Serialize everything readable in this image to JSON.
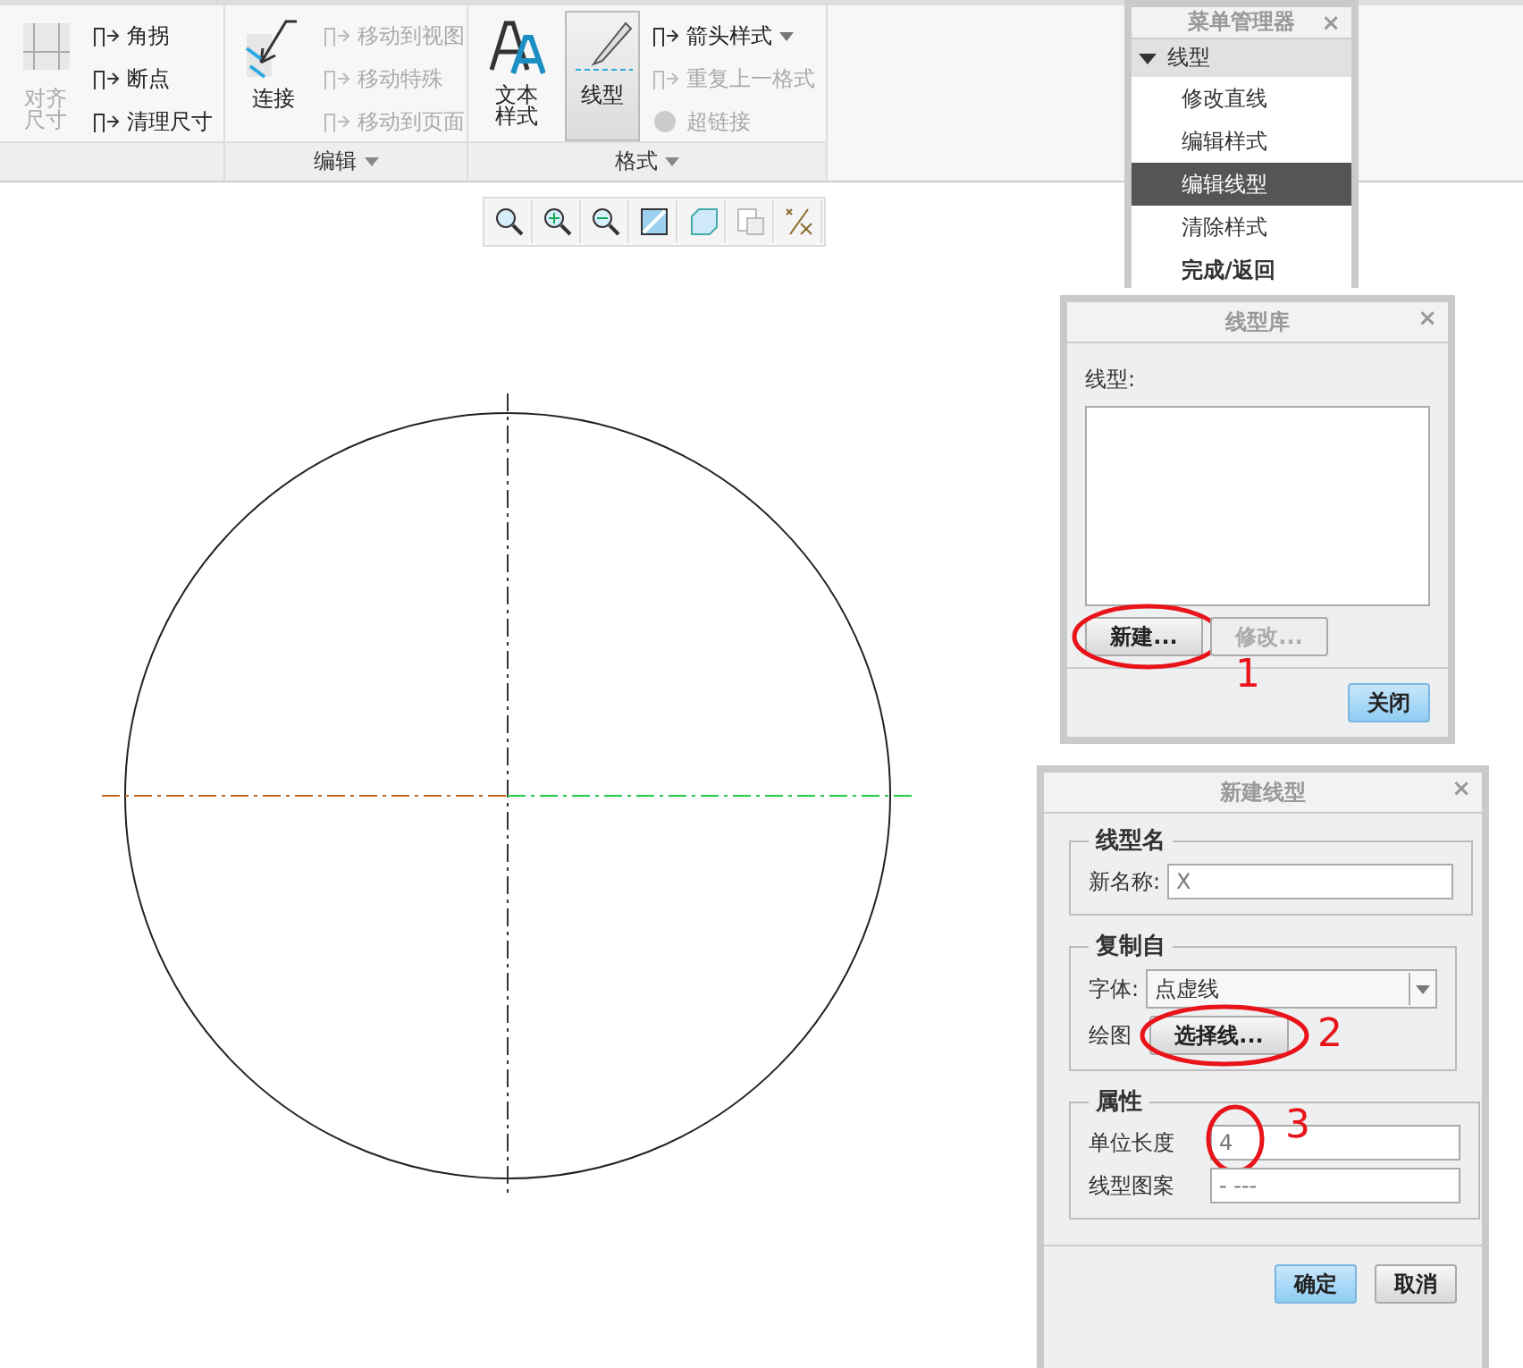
{
  "ribbon": {
    "groups": [
      {
        "items": [
          {
            "kind": "large",
            "label": "对齐尺寸",
            "disabled": true,
            "selected": false
          },
          {
            "kind": "small",
            "label": "角拐",
            "disabled": false
          },
          {
            "kind": "small",
            "label": "断点",
            "disabled": false
          },
          {
            "kind": "small",
            "label": "清理尺寸",
            "disabled": false
          }
        ]
      },
      {
        "label": "编辑",
        "items": [
          {
            "kind": "large",
            "label": "连接",
            "disabled": false,
            "selected": false
          },
          {
            "kind": "small",
            "label": "移动到视图",
            "disabled": true
          },
          {
            "kind": "small",
            "label": "移动特殊",
            "disabled": true
          },
          {
            "kind": "small",
            "label": "移动到页面",
            "disabled": true
          }
        ]
      },
      {
        "label": "格式",
        "items": [
          {
            "kind": "large",
            "label": "文本样式",
            "disabled": false,
            "selected": false
          },
          {
            "kind": "large",
            "label": "线型",
            "disabled": false,
            "selected": true
          },
          {
            "kind": "small",
            "label": "箭头样式",
            "disabled": false,
            "dropdown": true
          },
          {
            "kind": "small",
            "label": "重复上一格式",
            "disabled": true
          },
          {
            "kind": "small",
            "label": "超链接",
            "disabled": true
          }
        ]
      }
    ]
  },
  "menu_manager": {
    "title": "菜单管理器",
    "close": "×",
    "section": "线型",
    "items": [
      {
        "label": "修改直线",
        "kind": "option",
        "selected": false
      },
      {
        "label": "编辑样式",
        "kind": "option",
        "selected": false
      },
      {
        "label": "编辑线型",
        "kind": "option",
        "selected": true
      },
      {
        "label": "清除样式",
        "kind": "option",
        "selected": false
      },
      {
        "label": "完成/返回",
        "kind": "action",
        "selected": false
      }
    ]
  },
  "linetype_library": {
    "title": "线型库",
    "close": "×",
    "list_label": "线型:",
    "buttons": [
      {
        "label": "新建...",
        "disabled": false,
        "circled": true,
        "note": "1"
      },
      {
        "label": "修改...",
        "disabled": true,
        "circled": false
      }
    ],
    "close_button": {
      "label": "关闭",
      "default": true
    }
  },
  "new_linetype": {
    "title": "新建线型",
    "close": "×",
    "name_group": {
      "title": "线型名",
      "label": "新名称:",
      "value": "X"
    },
    "copy_group": {
      "title": "复制自",
      "font_label": "字体:",
      "font_value": "点虚线",
      "draw_label": "绘图",
      "pick": {
        "label": "选择线...",
        "circled": true,
        "note": "2"
      }
    },
    "props_group": {
      "title": "属性",
      "fields": [
        {
          "label": "单位长度",
          "value": "4",
          "circled": true,
          "note": "3"
        },
        {
          "label": "线型图案",
          "value": "- ---",
          "circled": false
        }
      ]
    },
    "buttons": [
      {
        "label": "确定",
        "default": true
      },
      {
        "label": "取消",
        "default": false
      }
    ]
  }
}
